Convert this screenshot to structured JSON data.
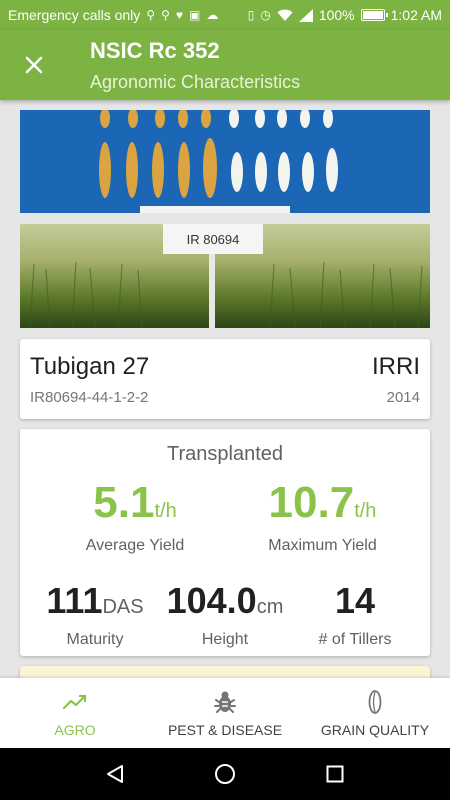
{
  "status_bar": {
    "carrier_text": "Emergency calls only",
    "battery": "100%",
    "time": "1:02 AM"
  },
  "app_bar": {
    "title": "NSIC Rc 352",
    "subtitle": "Agronomic Characteristics"
  },
  "variety": {
    "name": "Tubigan 27",
    "code": "IR80694-44-1-2-2",
    "institution": "IRRI",
    "year": "2014"
  },
  "photo_sign_text": "IR 80694",
  "yield": {
    "method": "Transplanted",
    "average": {
      "value": "5.1",
      "unit": "t/h",
      "label": "Average Yield"
    },
    "maximum": {
      "value": "10.7",
      "unit": "t/h",
      "label": "Maximum Yield"
    },
    "maturity": {
      "value": "111",
      "unit": "DAS",
      "label": "Maturity"
    },
    "height": {
      "value": "104.0",
      "unit": "cm",
      "label": "Height"
    },
    "tillers": {
      "value": "14",
      "unit": "",
      "label": "# of Tillers"
    }
  },
  "bottom_nav": {
    "items": [
      {
        "label": "AGRO",
        "icon": "trending-up-icon",
        "active": true
      },
      {
        "label": "PEST & DISEASE",
        "icon": "bug-icon",
        "active": false
      },
      {
        "label": "GRAIN QUALITY",
        "icon": "grain-icon",
        "active": false
      }
    ]
  },
  "colors": {
    "primary": "#7cb342",
    "accent": "#8bc34a",
    "photo_background": "#1b66b5"
  }
}
